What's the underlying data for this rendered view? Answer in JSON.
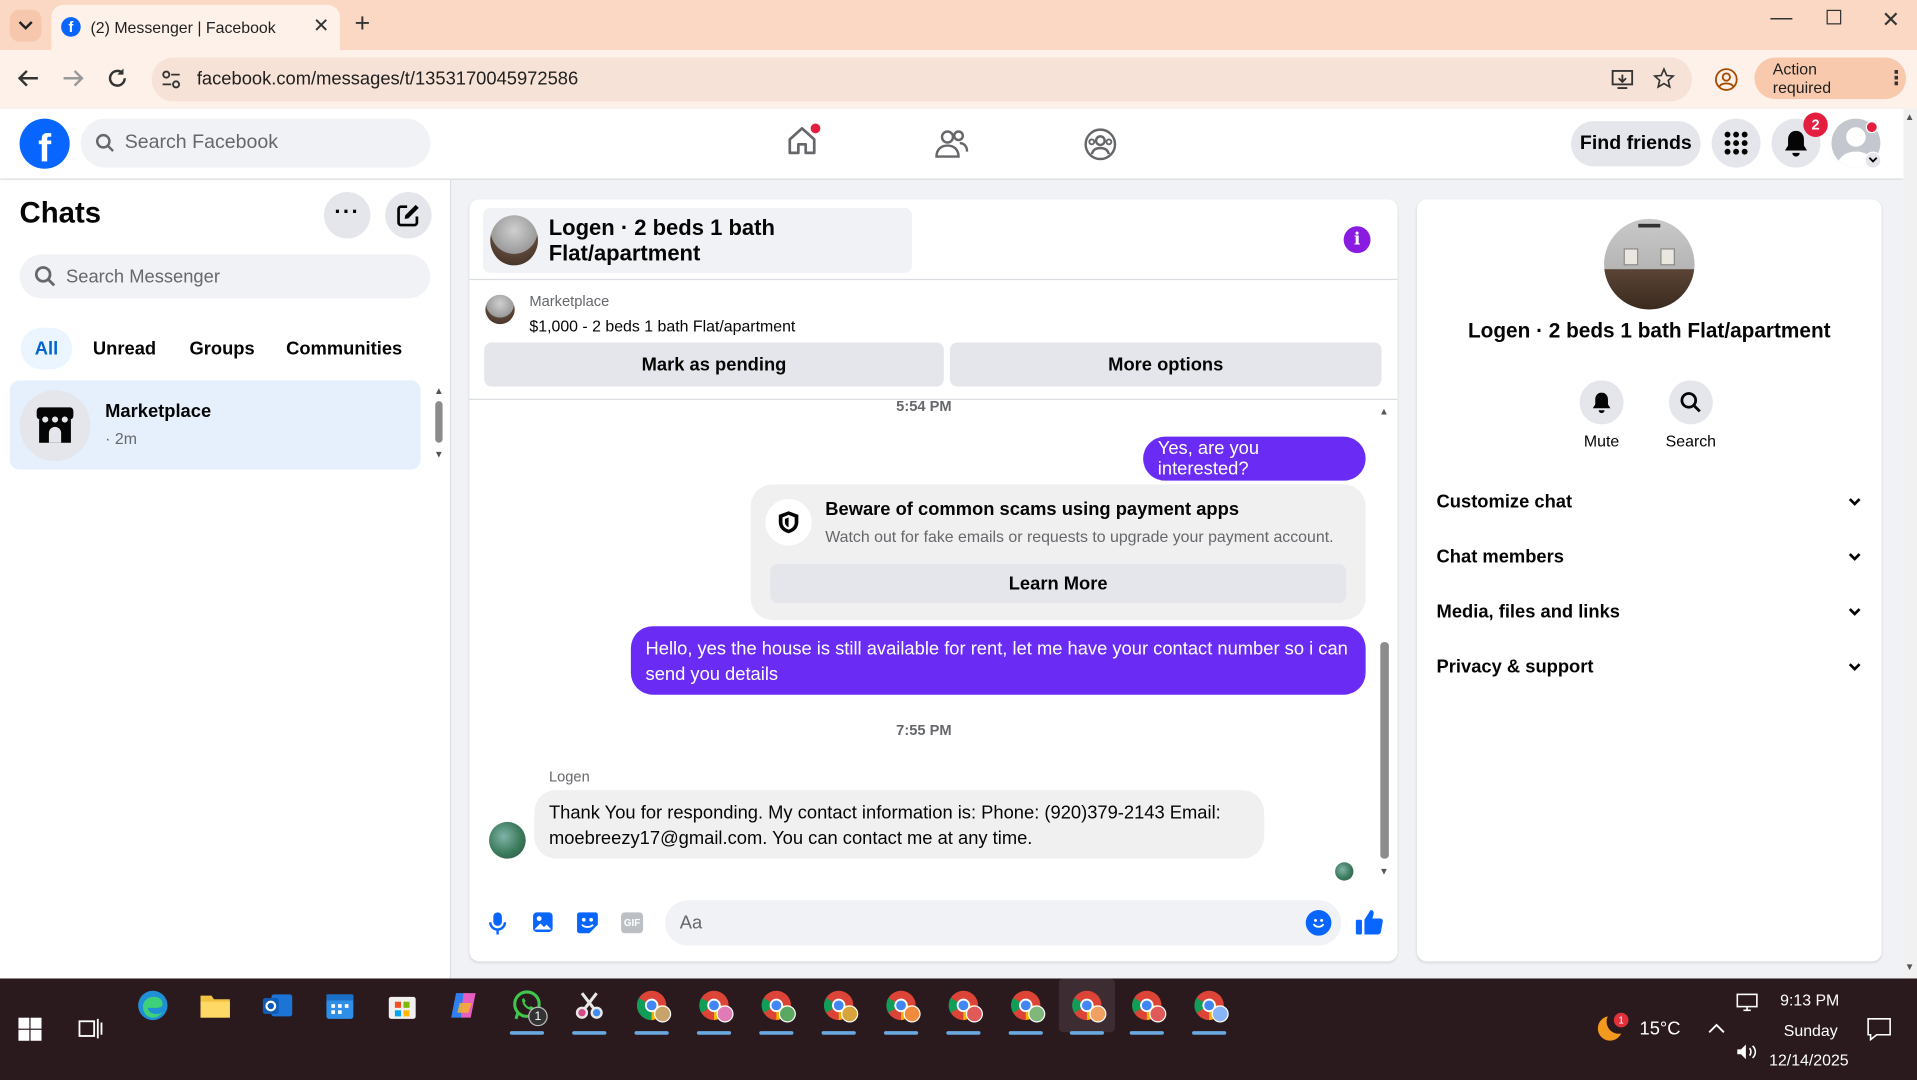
{
  "browser": {
    "tab_title": "(2) Messenger | Facebook",
    "url": "facebook.com/messages/t/1353170045972586",
    "action_required": "Action required"
  },
  "header": {
    "search_placeholder": "Search Facebook",
    "find_friends": "Find friends",
    "notification_count": "2"
  },
  "sidebar": {
    "title": "Chats",
    "search_placeholder": "Search Messenger",
    "filters": [
      "All",
      "Unread",
      "Groups",
      "Communities"
    ],
    "chats": [
      {
        "name": "Marketplace",
        "meta": "· 2m"
      }
    ]
  },
  "chat": {
    "title": "Logen · 2 beds 1 bath Flat/apartment",
    "listing": {
      "source": "Marketplace",
      "summary": "$1,000 - 2 beds 1 bath Flat/apartment",
      "pending_btn": "Mark as pending",
      "options_btn": "More options"
    },
    "time1": "5:54 PM",
    "msg_out_1": "Yes, are you interested?",
    "warning": {
      "title": "Beware of common scams using payment apps",
      "body": "Watch out for fake emails or requests to upgrade your payment account.",
      "button": "Learn More"
    },
    "msg_out_2": "Hello, yes the house is still available for rent, let me have your contact number so i can send you details",
    "time2": "7:55 PM",
    "sender": "Logen",
    "msg_in_1": "Thank You for responding. My contact information is: Phone: (920)379-2143 Email: moebreezy17@gmail.com. You can contact me at any time.",
    "composer_placeholder": "Aa"
  },
  "info": {
    "title": "Logen · 2 beds 1 bath Flat/apartment",
    "mute": "Mute",
    "search": "Search",
    "sections": [
      "Customize chat",
      "Chat members",
      "Media, files and links",
      "Privacy & support"
    ]
  },
  "taskbar": {
    "temperature": "15°C",
    "weather_badge": "1",
    "whatsapp_badge": "1",
    "time": "9:13 PM",
    "day": "Sunday",
    "date": "12/14/2025"
  },
  "colors": {
    "fb_blue": "#0866ff",
    "bubble_purple": "#6a2cf5",
    "info_purple": "#8a1be0",
    "tab_bar": "#fbd8c3",
    "taskbar": "#2a1a1e"
  }
}
